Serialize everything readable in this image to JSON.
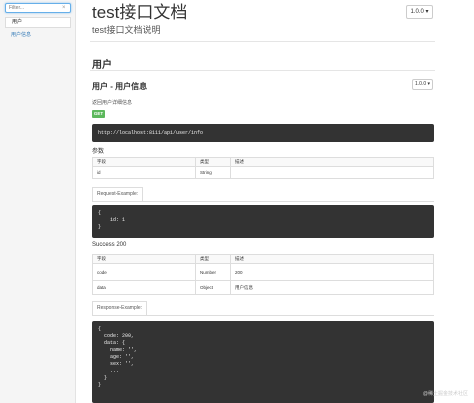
{
  "sidebar": {
    "filter_placeholder": "Filter...",
    "clear_label": "×",
    "group_label": "用户",
    "items": [
      {
        "label": "用户信息"
      }
    ]
  },
  "header": {
    "title": "test接口文档",
    "subtitle": "test接口文档说明",
    "version": "1.0.0 ▾"
  },
  "section": {
    "title": "用户"
  },
  "api": {
    "title": "用户 - 用户信息",
    "version": "1.0.0 ▾",
    "description": "返回用户详细信息",
    "method": "GET",
    "url": "http://localhost:8111/api/user/info"
  },
  "params": {
    "heading": "参数",
    "columns": [
      "字段",
      "类型",
      "描述"
    ],
    "rows": [
      [
        "id",
        "String",
        ""
      ]
    ]
  },
  "request_example": {
    "tab_label": "Request-Example:",
    "code": "{\n    id: 1\n}"
  },
  "success": {
    "heading": "Success 200",
    "columns": [
      "字段",
      "类型",
      "描述"
    ],
    "rows": [
      [
        "code",
        "Number",
        "200"
      ],
      [
        "data",
        "Object",
        "用户信息"
      ]
    ]
  },
  "response_example": {
    "tab_label": "Response-Example:",
    "code": "{\n  code: 200,\n  data: {\n    name: '',\n    age: '',\n    sex: '',\n    ...\n  }\n}"
  },
  "watermark": "@稀土掘金技术社区",
  "colors": {
    "accent": "#337ab7",
    "get_badge": "#5cb85c",
    "code_bg": "#333333"
  }
}
